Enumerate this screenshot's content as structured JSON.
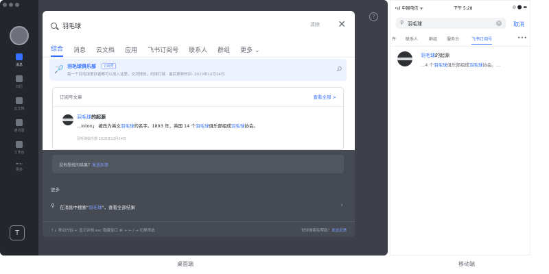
{
  "desktop": {
    "rail": {
      "items": [
        {
          "label": "消息",
          "icon": "chat-icon"
        },
        {
          "label": "日历",
          "icon": "calendar-icon"
        },
        {
          "label": "云文档",
          "icon": "doc-icon"
        },
        {
          "label": "通讯录",
          "icon": "contacts-icon"
        },
        {
          "label": "工作台",
          "icon": "workplace-icon"
        },
        {
          "label": "更多",
          "icon": "more-icon"
        }
      ],
      "bottom_letter": "T"
    },
    "search": {
      "query": "羽毛球",
      "hint": "清除",
      "close": "✕"
    },
    "tabs": [
      "综合",
      "消息",
      "云文档",
      "应用",
      "飞书订阅号",
      "联系人",
      "群组",
      "更多 ⌄"
    ],
    "group_result": {
      "title": "羽毛球俱乐部",
      "badge": "订阅号",
      "desc": "每一个羽毛球爱好者都可以加入这里，交流球技，约球打球 · 最后更新时间: 2020年12月14日"
    },
    "subscription": {
      "title": "订阅号文章",
      "more": "查看全部 >",
      "article_title_prefix": "羽毛球",
      "article_title_rest": "的起源",
      "article_body_1": "...inton」 被改为英文",
      "article_body_hl1": "羽毛球",
      "article_body_2": "的名字。1893 年，英国 14 个",
      "article_body_hl2": "羽毛球",
      "article_body_3": "俱乐部组成",
      "article_body_hl3": "羽毛球",
      "article_body_4": "协会。",
      "article_meta": "羽毛球俱乐部 2020年12月14日"
    },
    "feedback": {
      "text": "没有想找的结果？",
      "link": "发送反馈"
    },
    "more_section": {
      "label": "更多",
      "text_prefix": "在消息中搜索\"",
      "text_hl": "羽毛球",
      "text_suffix": "\"，查看全部结果"
    },
    "footer": {
      "keys": "↑↓ 移动光标    ↵ 显示详情    esc 隐藏窗口    ⌘ + ← / → 切换筛选",
      "right_text": "觉得搜索有帮助？",
      "right_link": "发送反馈"
    },
    "caption": "桌面端"
  },
  "mobile": {
    "status": {
      "carrier": "•ııl 中国电信 ᯤ",
      "time": "下午 5:28",
      "right": "◎ ⬤ ▬"
    },
    "search": {
      "query": "羽毛球",
      "cancel": "取消"
    },
    "tabs": [
      "件",
      "联系人",
      "群组",
      "服务台",
      "飞书订阅号"
    ],
    "result": {
      "title_hl": "羽毛球",
      "title_rest": "的起源",
      "body_1": "...4 个",
      "body_hl1": "羽毛球",
      "body_2": "俱乐部组成",
      "body_hl2": "羽毛球",
      "body_3": "协会。..."
    },
    "caption": "移动端"
  },
  "colors": {
    "accent": "#3370ff",
    "rail": "#23262c",
    "overlay": "#3d4049"
  }
}
